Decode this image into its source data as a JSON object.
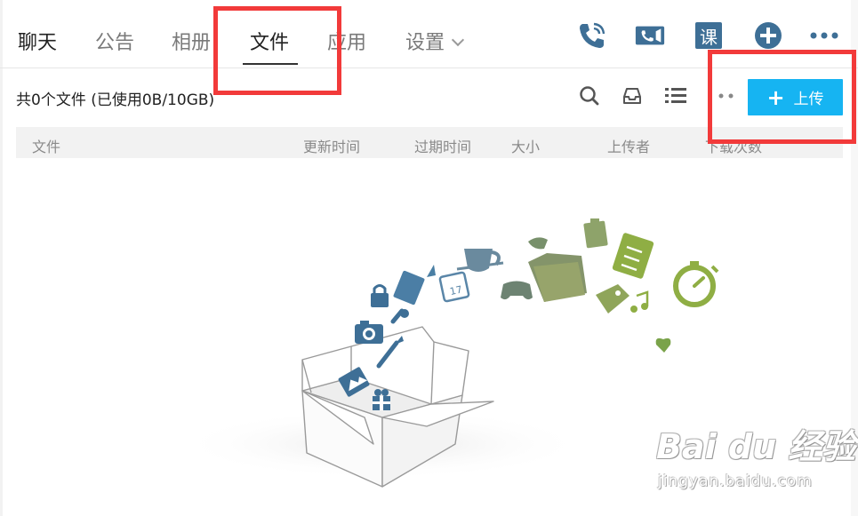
{
  "nav": {
    "tabs": [
      {
        "label": "聊天"
      },
      {
        "label": "公告"
      },
      {
        "label": "相册"
      },
      {
        "label": "文件"
      },
      {
        "label": "应用"
      },
      {
        "label": "设置"
      }
    ],
    "active_tab": "文件",
    "icons": {
      "voice_call": "phone-call-icon",
      "video_call": "video-camera-icon",
      "course": "课",
      "add": "add-circle-icon",
      "more": "more-dots-icon"
    }
  },
  "toolbar": {
    "file_info": "共0个文件 (已使用0B/10GB)",
    "upload_label": "上传",
    "icons": [
      "search-icon",
      "inbox-tray-icon",
      "list-view-icon",
      "more-dots-icon"
    ]
  },
  "table": {
    "columns": [
      "文件",
      "更新时间",
      "过期时间",
      "大小",
      "上传者",
      "下载次数"
    ]
  },
  "watermark": {
    "logo": "Bai du 经验",
    "url": "jingyan.baidu.com"
  },
  "colors": {
    "accent": "#16b4f2",
    "highlight": "#f23a3a",
    "icon_blue": "#3e6f96"
  }
}
